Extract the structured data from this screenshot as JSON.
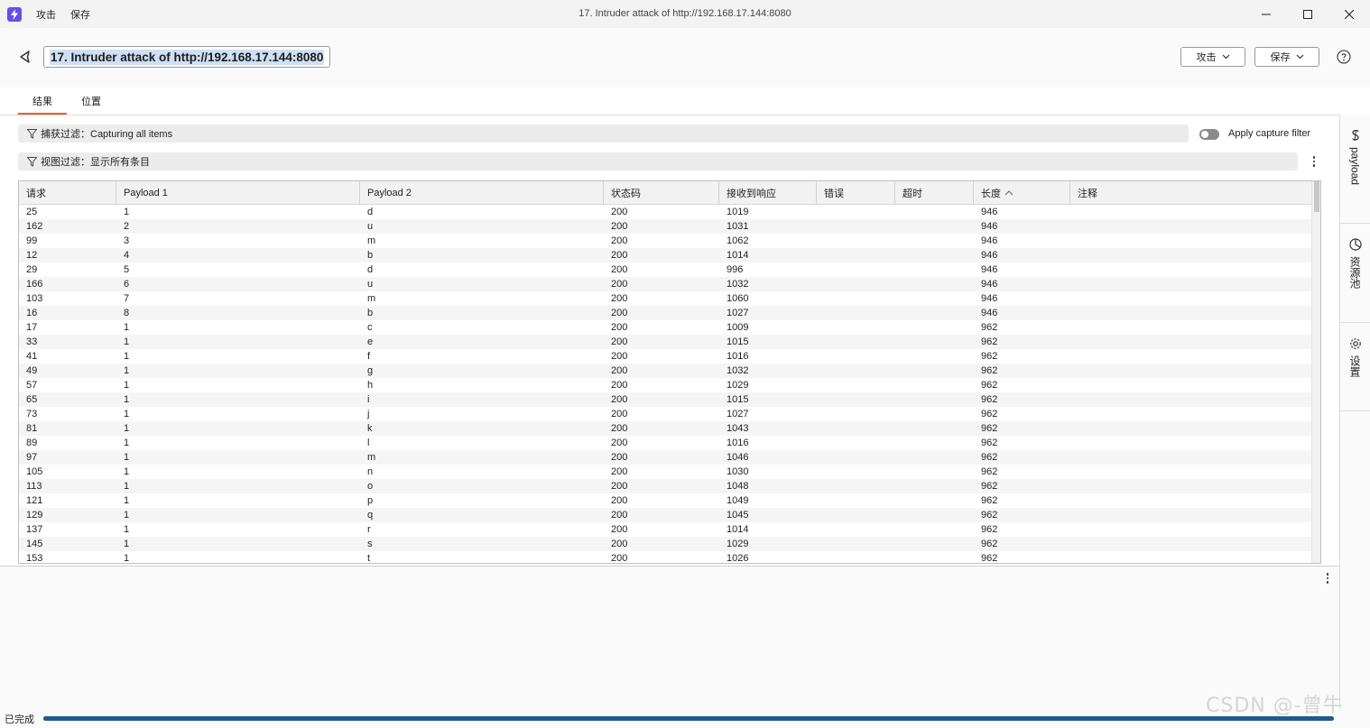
{
  "window": {
    "title": "17. Intruder attack of http://192.168.17.144:8080",
    "menu": [
      "攻击",
      "保存"
    ]
  },
  "header": {
    "attack_title": "17. Intruder attack of http://192.168.17.144:8080",
    "attack_button": "攻击",
    "save_button": "保存"
  },
  "tabs": [
    {
      "label": "结果",
      "active": true
    },
    {
      "label": "位置",
      "active": false
    }
  ],
  "filters": {
    "capture_filter": "捕获过滤：Capturing all items",
    "apply_capture_filter": "Apply capture filter",
    "view_filter": "视图过滤：显示所有条目"
  },
  "table": {
    "columns": [
      "请求",
      "Payload 1",
      "Payload 2",
      "状态码",
      "接收到响应",
      "错误",
      "超时",
      "长度",
      "注释"
    ],
    "sorted_column": "长度",
    "rows": [
      [
        "25",
        "1",
        "d",
        "200",
        "1019",
        "",
        "",
        "946",
        ""
      ],
      [
        "162",
        "2",
        "u",
        "200",
        "1031",
        "",
        "",
        "946",
        ""
      ],
      [
        "99",
        "3",
        "m",
        "200",
        "1062",
        "",
        "",
        "946",
        ""
      ],
      [
        "12",
        "4",
        "b",
        "200",
        "1014",
        "",
        "",
        "946",
        ""
      ],
      [
        "29",
        "5",
        "d",
        "200",
        "996",
        "",
        "",
        "946",
        ""
      ],
      [
        "166",
        "6",
        "u",
        "200",
        "1032",
        "",
        "",
        "946",
        ""
      ],
      [
        "103",
        "7",
        "m",
        "200",
        "1060",
        "",
        "",
        "946",
        ""
      ],
      [
        "16",
        "8",
        "b",
        "200",
        "1027",
        "",
        "",
        "946",
        ""
      ],
      [
        "17",
        "1",
        "c",
        "200",
        "1009",
        "",
        "",
        "962",
        ""
      ],
      [
        "33",
        "1",
        "e",
        "200",
        "1015",
        "",
        "",
        "962",
        ""
      ],
      [
        "41",
        "1",
        "f",
        "200",
        "1016",
        "",
        "",
        "962",
        ""
      ],
      [
        "49",
        "1",
        "g",
        "200",
        "1032",
        "",
        "",
        "962",
        ""
      ],
      [
        "57",
        "1",
        "h",
        "200",
        "1029",
        "",
        "",
        "962",
        ""
      ],
      [
        "65",
        "1",
        "i",
        "200",
        "1015",
        "",
        "",
        "962",
        ""
      ],
      [
        "73",
        "1",
        "j",
        "200",
        "1027",
        "",
        "",
        "962",
        ""
      ],
      [
        "81",
        "1",
        "k",
        "200",
        "1043",
        "",
        "",
        "962",
        ""
      ],
      [
        "89",
        "1",
        "l",
        "200",
        "1016",
        "",
        "",
        "962",
        ""
      ],
      [
        "97",
        "1",
        "m",
        "200",
        "1046",
        "",
        "",
        "962",
        ""
      ],
      [
        "105",
        "1",
        "n",
        "200",
        "1030",
        "",
        "",
        "962",
        ""
      ],
      [
        "113",
        "1",
        "o",
        "200",
        "1048",
        "",
        "",
        "962",
        ""
      ],
      [
        "121",
        "1",
        "p",
        "200",
        "1049",
        "",
        "",
        "962",
        ""
      ],
      [
        "129",
        "1",
        "q",
        "200",
        "1045",
        "",
        "",
        "962",
        ""
      ],
      [
        "137",
        "1",
        "r",
        "200",
        "1014",
        "",
        "",
        "962",
        ""
      ],
      [
        "145",
        "1",
        "s",
        "200",
        "1029",
        "",
        "",
        "962",
        ""
      ],
      [
        "153",
        "1",
        "t",
        "200",
        "1026",
        "",
        "",
        "962",
        ""
      ]
    ]
  },
  "side_panel": [
    "payload",
    "资源池",
    "设置"
  ],
  "status": {
    "text": "已完成",
    "progress": 1.0
  },
  "watermark": "CSDN @-曾牛",
  "colors": {
    "accent": "#e8602c",
    "progress": "#24598d",
    "app_icon": "#6a4de3"
  }
}
